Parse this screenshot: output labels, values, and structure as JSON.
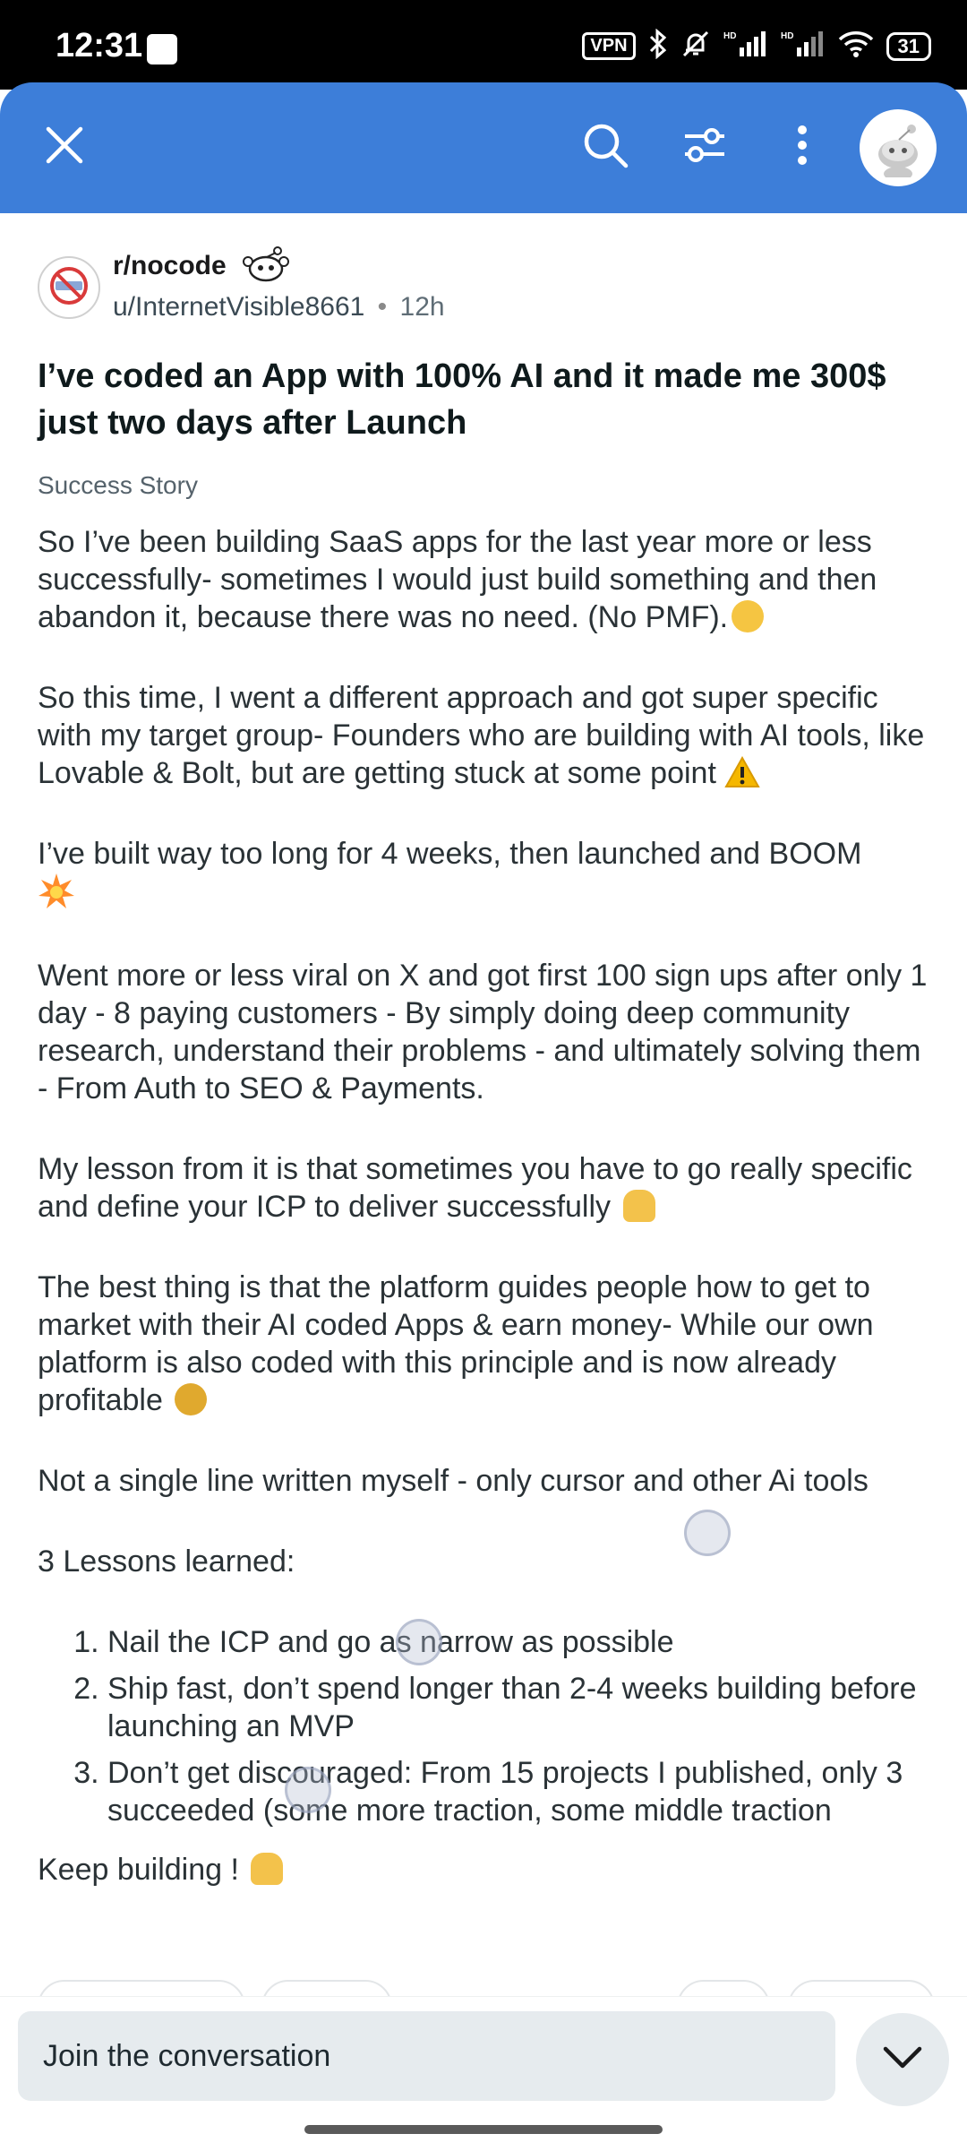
{
  "status_bar": {
    "time": "12:31",
    "vpn_label": "VPN",
    "hd1": "HD",
    "hd2": "HD",
    "battery": "31"
  },
  "app_bar": {
    "background_color": "#3d7ed9",
    "icons": [
      "close-icon",
      "search-icon",
      "filter-icon",
      "more-options-icon",
      "avatar"
    ]
  },
  "post": {
    "subreddit": "r/nocode",
    "author": "u/InternetVisible8661",
    "separator": "•",
    "age": "12h",
    "title": "I’ve coded an App with 100% AI and it made me 300$ just two days after Launch",
    "flair": "Success Story",
    "paragraphs": [
      "So I’ve been building SaaS apps for the last year more or less successfully- sometimes I would just build something and then abandon it, because there was no need. (No PMF).",
      "So this time, I went a different approach and got super specific with my target group- Founders who are building with AI tools, like Lovable & Bolt, but are getting stuck at some point",
      "I’ve built way too long for 4 weeks, then launched and BOOM",
      "Went more or less viral on X and got first 100 sign ups after only 1 day - 8 paying customers - By simply doing deep community research, understand their problems - and ultimately solving them - From Auth to SEO & Payments.",
      "My lesson from it is that sometimes you have to go really specific and define your ICP to deliver successfully",
      "The best thing is that the platform guides people how to get to market with their AI coded Apps & earn money- While our own platform is also coded with this principle and is now already profitable",
      "Not a single line written myself - only cursor and other Ai tools"
    ],
    "emojis": [
      "sweat-smile-emoji",
      "warning-emoji",
      "explosion-emoji",
      "pray-emoji",
      "money-bag-emoji",
      "pray-emoji"
    ],
    "lessons_title": "3 Lessons learned:",
    "lessons": [
      "Nail the ICP and go as narrow as possible",
      "Ship fast, don’t spend longer than 2-4 weeks building before launching an MVP",
      "Don’t get discouraged: From 15 projects I published, only 3 succeeded (some more traction, some middle traction"
    ],
    "closing": "Keep building !"
  },
  "comment_bar": {
    "placeholder": "Join the conversation"
  }
}
